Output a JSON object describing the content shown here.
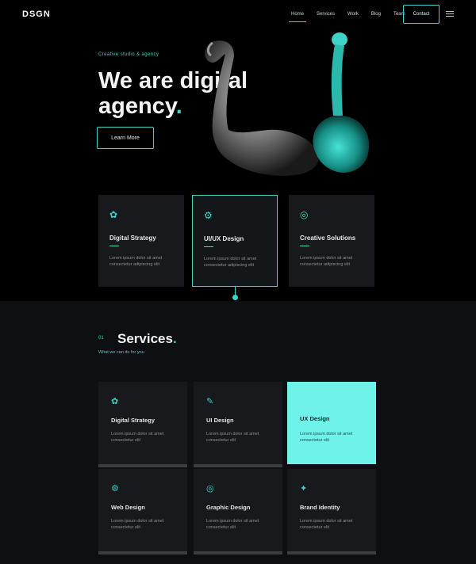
{
  "header": {
    "logo": "DSGN",
    "nav": [
      "Home",
      "Services",
      "Work",
      "Blog",
      "Team"
    ],
    "cta": "Contact",
    "menu_icon": "hamburger-icon"
  },
  "hero": {
    "eyebrow": "Creative studio & agency",
    "headline_line1": "We are digital",
    "headline_line2": "agency",
    "headline_dot": ".",
    "button": "Learn More"
  },
  "features": [
    {
      "icon": "leaf-icon",
      "title": "Digital Strategy",
      "text": "Lorem ipsum dolor sit amet consectetur adipiscing elit"
    },
    {
      "icon": "gear-icon",
      "title": "UI/UX Design",
      "text": "Lorem ipsum dolor sit amet consectetur adipiscing elit"
    },
    {
      "icon": "target-icon",
      "title": "Creative Solutions",
      "text": "Lorem ipsum dolor sit amet consectetur adipiscing elit"
    }
  ],
  "services": {
    "mark": "01",
    "heading": "Services",
    "heading_dot": ".",
    "sub": "What we can do for you",
    "items": [
      {
        "icon": "leaf-icon",
        "title": "Digital Strategy",
        "text": "Lorem ipsum dolor sit amet consectetur elit"
      },
      {
        "icon": "pen-icon",
        "title": "UI Design",
        "text": "Lorem ipsum dolor sit amet consectetur elit"
      },
      {
        "icon": "code-icon",
        "title": "UX Design",
        "text": "Lorem ipsum dolor sit amet consectetur elit"
      },
      {
        "icon": "gear-icon",
        "title": "Web Design",
        "text": "Lorem ipsum dolor sit amet consectetur elit"
      },
      {
        "icon": "target-icon",
        "title": "Graphic Design",
        "text": "Lorem ipsum dolor sit amet consectetur elit"
      },
      {
        "icon": "star-icon",
        "title": "Brand Identity",
        "text": "Lorem ipsum dolor sit amet consectetur elit"
      }
    ]
  },
  "colors": {
    "accent": "#3fd2c7",
    "highlight": "#6ff2ea",
    "card": "#17191c",
    "background": "#000000"
  }
}
